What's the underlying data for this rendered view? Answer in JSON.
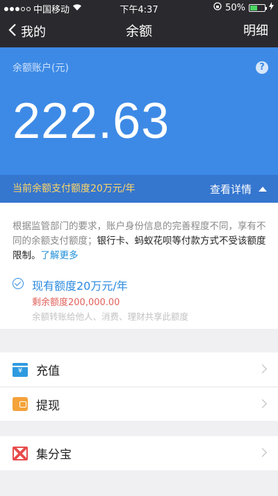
{
  "status_bar": {
    "carrier": "中国移动",
    "time": "下午4:37",
    "battery_text": "50%",
    "battery_level": 0.5,
    "signal_bars_filled": 3,
    "signal_bars_total": 5
  },
  "nav": {
    "back_label": "我的",
    "title": "余额",
    "right_label": "明细"
  },
  "balance": {
    "label": "余额账户(元)",
    "amount": "222.63",
    "help_glyph": "?"
  },
  "limit": {
    "text": "当前余额支付额度20万元/年",
    "detail_label": "查看详情"
  },
  "info": {
    "para_grey": "根据监管部门的要求，账户身份信息的完善程度不同，享有不同的余额支付额度；",
    "para_dark": "银行卡、蚂蚁花呗等付款方式不受该额度限制。",
    "para_link": "了解更多",
    "quota_title": "现有额度20万元/年",
    "quota_remaining": "剩余额度200,000.00",
    "quota_note": "余额转账给他人、消费、理财共享此额度"
  },
  "actions": [
    {
      "label": "充值",
      "icon": "recharge-icon",
      "icon_glyph": "¥"
    },
    {
      "label": "提现",
      "icon": "withdraw-icon"
    }
  ],
  "extras": [
    {
      "label": "集分宝",
      "icon": "jifenbao-icon"
    }
  ],
  "colors": {
    "nav_bg": "#2a2a2e",
    "hero_bg": "#3d8ae6",
    "limit_bg": "#3576cf",
    "limit_text": "#ffd666",
    "link": "#1d8ed8",
    "remaining": "#e0605a"
  }
}
